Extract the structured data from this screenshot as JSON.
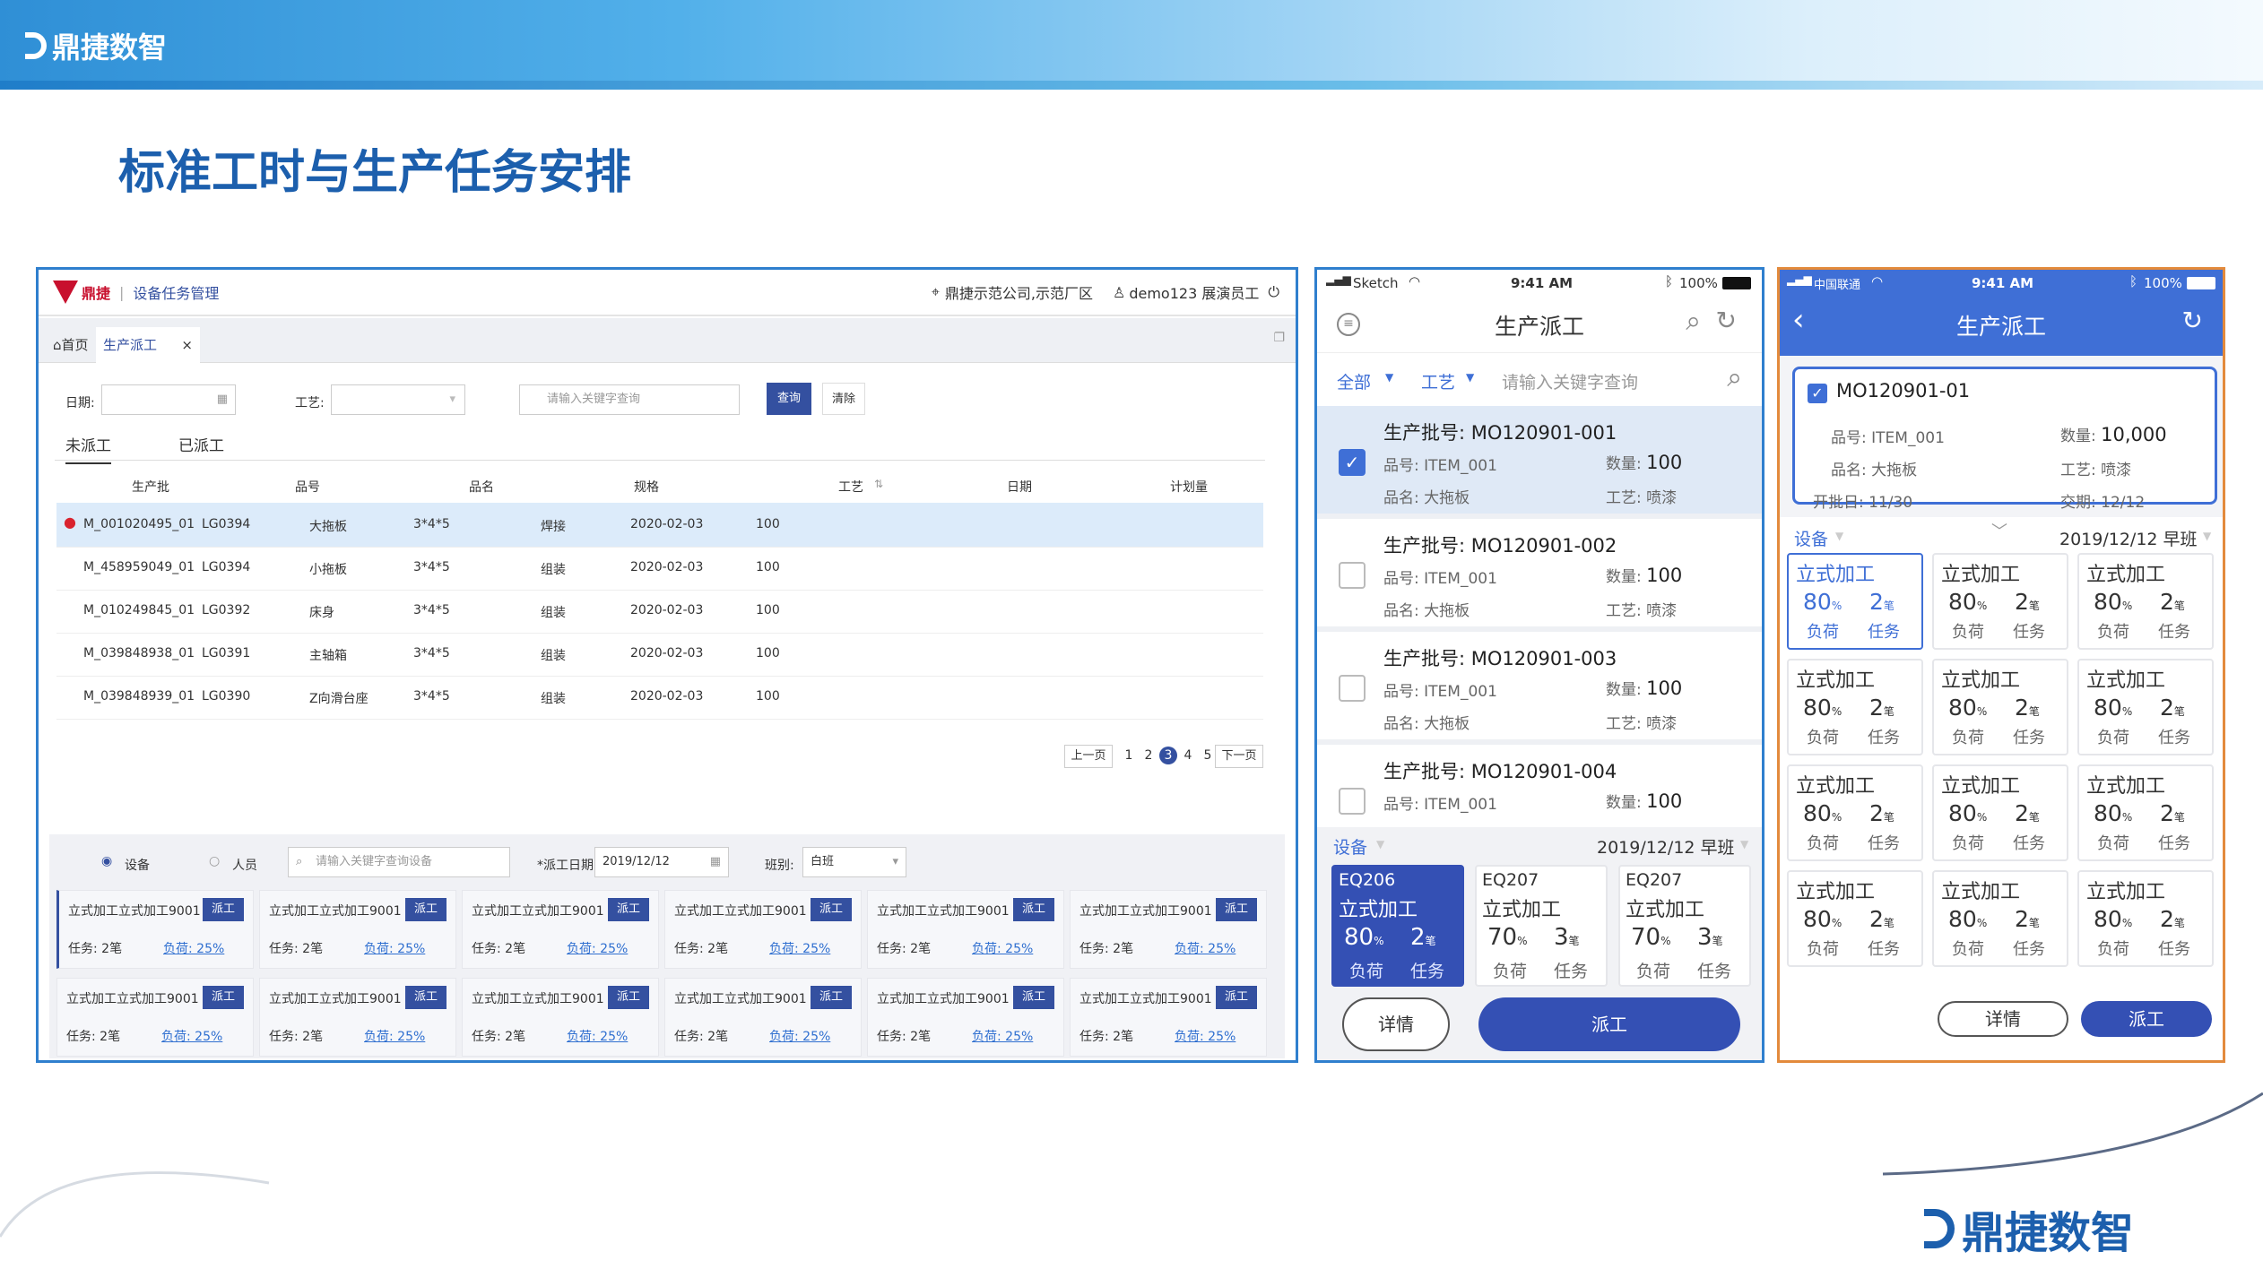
{
  "brand": {
    "name": "鼎捷数智"
  },
  "slide": {
    "title": "标准工时与生产任务安排"
  },
  "pc": {
    "logo_text": "鼎捷",
    "module": "设备任务管理",
    "location": "鼎捷示范公司,示范厂区",
    "user": "demo123 展演员工",
    "tabs": [
      "首页",
      "生产派工"
    ],
    "filters": {
      "date_label": "日期:",
      "craft_label": "工艺:",
      "search_placeholder": "请输入关键字查询",
      "query": "查询",
      "clear": "清除"
    },
    "status_tabs": [
      "未派工",
      "已派工"
    ],
    "columns": [
      "生产批",
      "品号",
      "品名",
      "规格",
      "工艺",
      "日期",
      "计划量"
    ],
    "rows": [
      [
        "M_001020495_01",
        "LG0394",
        "大拖板",
        "3*4*5",
        "焊接",
        "2020-02-03",
        "100"
      ],
      [
        "M_458959049_01",
        "LG0394",
        "小拖板",
        "3*4*5",
        "组装",
        "2020-02-03",
        "100"
      ],
      [
        "M_010249845_01",
        "LG0392",
        "床身",
        "3*4*5",
        "组装",
        "2020-02-03",
        "100"
      ],
      [
        "M_039848938_01",
        "LG0391",
        "主轴箱",
        "3*4*5",
        "组装",
        "2020-02-03",
        "100"
      ],
      [
        "M_039848939_01",
        "LG0390",
        "Z向滑台座",
        "3*4*5",
        "组装",
        "2020-02-03",
        "100"
      ]
    ],
    "pager": {
      "prev": "上一页",
      "pages": [
        "1",
        "2",
        "3",
        "4",
        "5"
      ],
      "current": "3",
      "next": "下一页"
    },
    "dispatch": {
      "radio_device": "设备",
      "radio_person": "人员",
      "search_placeholder": "请输入关键字查询设备",
      "date_label": "*派工日期:",
      "date": "2019/12/12",
      "shift_label": "班别:",
      "shift": "白班"
    },
    "card": {
      "name": "立式加工立式加工9001",
      "button": "派工",
      "task": "任务: 2笔",
      "load": "负荷: 25%"
    }
  },
  "phone1": {
    "status": {
      "carrier": "Sketch",
      "time": "9:41 AM",
      "battery": "100%"
    },
    "title": "生产派工",
    "filter": {
      "all": "全部",
      "craft": "工艺",
      "placeholder": "请输入关键字查询"
    },
    "tasks": [
      {
        "no": "生产批号: MO120901-001",
        "item_label": "品号: ",
        "item": "ITEM_001",
        "qty_label": "数量: ",
        "qty": "100",
        "name_label": "品名: ",
        "name": "大拖板",
        "craft_label": "工艺: ",
        "craft": "喷漆",
        "checked": true
      },
      {
        "no": "生产批号: MO120901-002",
        "item_label": "品号: ",
        "item": "ITEM_001",
        "qty_label": "数量: ",
        "qty": "100",
        "name_label": "品名: ",
        "name": "大拖板",
        "craft_label": "工艺: ",
        "craft": "喷漆",
        "checked": false
      },
      {
        "no": "生产批号: MO120901-003",
        "item_label": "品号: ",
        "item": "ITEM_001",
        "qty_label": "数量: ",
        "qty": "100",
        "name_label": "品名: ",
        "name": "大拖板",
        "craft_label": "工艺: ",
        "craft": "喷漆",
        "checked": false
      },
      {
        "no": "生产批号: MO120901-004",
        "item_label": "品号: ",
        "item": "ITEM_001",
        "qty_label": "数量: ",
        "qty": "100",
        "checked": false
      }
    ],
    "device_label": "设备",
    "date_shift": "2019/12/12 早班",
    "equipment": [
      {
        "code": "EQ206",
        "name": "立式加工",
        "pct": "80",
        "pct_unit": "%",
        "tasks": "2",
        "tasks_unit": "笔",
        "load": "负荷",
        "task": "任务",
        "active": true
      },
      {
        "code": "EQ207",
        "name": "立式加工",
        "pct": "70",
        "pct_unit": "%",
        "tasks": "3",
        "tasks_unit": "笔",
        "load": "负荷",
        "task": "任务",
        "active": false
      },
      {
        "code": "EQ207",
        "name": "立式加工",
        "pct": "70",
        "pct_unit": "%",
        "tasks": "3",
        "tasks_unit": "笔",
        "load": "负荷",
        "task": "任务",
        "active": false
      }
    ],
    "detail": "详情",
    "dispatch": "派工"
  },
  "phone2": {
    "status": {
      "carrier": "中国联通",
      "time": "9:41 AM",
      "battery": "100%"
    },
    "title": "生产派工",
    "order": {
      "no": "MO120901-01",
      "item_label": "品号: ",
      "item": "ITEM_001",
      "qty_label": "数量: ",
      "qty": "10,000",
      "name_label": "品名: ",
      "name": "大拖板",
      "craft_label": "工艺: ",
      "craft": "喷漆",
      "start_label": "开批日: ",
      "start": "11/30",
      "due_label": "交期: ",
      "due": "12/12"
    },
    "device_label": "设备",
    "date_shift": "2019/12/12 早班",
    "tile": {
      "name": "立式加工",
      "pct": "80",
      "pct_unit": "%",
      "tasks": "2",
      "tasks_unit": "笔",
      "load": "负荷",
      "task": "任务"
    },
    "detail": "详情",
    "dispatch": "派工"
  },
  "colors": {
    "primary": "#3450a0",
    "frame": "#2f7fce",
    "accent": "#e38a3c",
    "title": "#1c5fad"
  }
}
